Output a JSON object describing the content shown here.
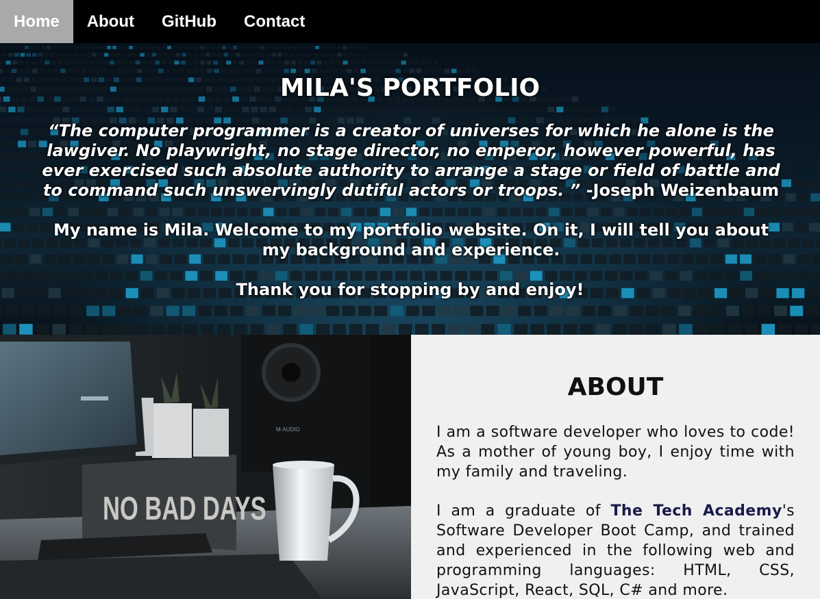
{
  "nav": {
    "items": [
      {
        "label": "Home",
        "active": true
      },
      {
        "label": "About",
        "active": false
      },
      {
        "label": "GitHub",
        "active": false
      },
      {
        "label": "Contact",
        "active": false
      }
    ],
    "active_bg": "#a9a9a9"
  },
  "hero": {
    "title": "MILA'S PORTFOLIO",
    "quote": "“The computer programmer is a creator of universes for which he alone is the lawgiver. No playwright, no stage director, no emperor, however powerful, has ever exercised such absolute authority to arrange a stage or field of battle and to command such unswervingly dutiful actors or troops. ”",
    "quote_author": " -Joseph Weizenbaum",
    "intro": "My name is Mila. Welcome to my portfolio website. On it, I will tell you about my background and experience.",
    "thanks": "Thank you for stopping by and enjoy!"
  },
  "photo": {
    "sign_text": "NO BAD DAYS",
    "speaker_brand": "M-AUDIO"
  },
  "about": {
    "title": "ABOUT",
    "p1": "I am a software developer who loves to code! As a mother of young boy, I enjoy time with my family and traveling.",
    "p2_before": "I am a graduate of ",
    "p2_link": "The Tech Academy",
    "p2_after": "'s Software Developer Boot Camp, and trained and experienced in the following web and programming languages: HTML, CSS, JavaScript, React, SQL, C# and more."
  }
}
